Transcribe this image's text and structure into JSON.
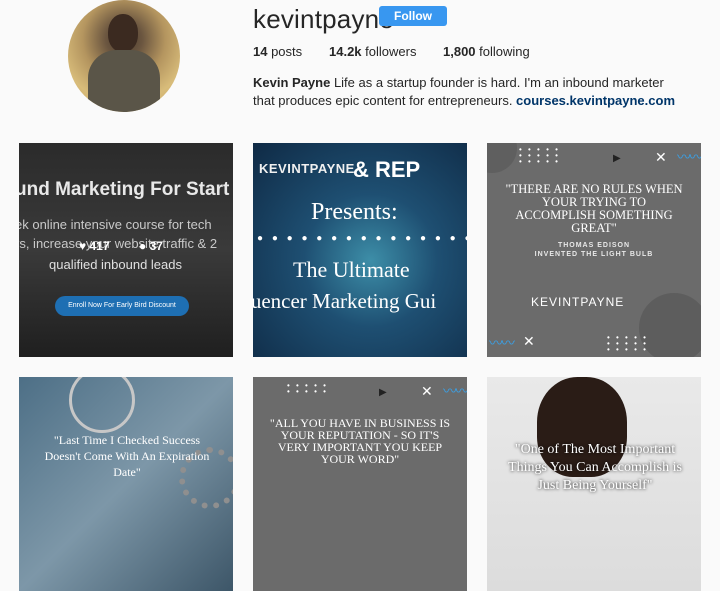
{
  "profile": {
    "username": "kevintpayne",
    "follow_label": "Follow",
    "posts_count": "14",
    "posts_label": " posts",
    "followers_count": "14.2k",
    "followers_label": " followers",
    "following_count": "1,800",
    "following_label": " following",
    "bio_name": "Kevin Payne",
    "bio_text": " Life as a startup founder is hard. I'm an inbound marketer that produces epic content for entrepreneurs. ",
    "bio_link": "courses.kevintpayne.com"
  },
  "posts": [
    {
      "title": "und Marketing For Start",
      "sub1": "ek online intensive course for tech",
      "sub2": "rs, increase your website traffic & 2",
      "sub3": "qualified inbound leads",
      "likes": "417",
      "comments": "37",
      "cta": "Enroll Now For Early Bird Discount"
    },
    {
      "brand": "KEVINTPAYNE",
      "rep": "& REP",
      "presents": "Presents:",
      "dots": "● ● ● ● ● ● ● ● ● ● ● ● ● ● ● ● ●",
      "ultimate": "The Ultimate",
      "influencer": "luencer Marketing Gui"
    },
    {
      "quote": "\"THERE ARE NO RULES WHEN YOUR TRYING TO ACCOMPLISH SOMETHING GREAT\"",
      "author": "THOMAS EDISON",
      "author_sub": "INVENTED THE LIGHT BULB",
      "logo": "KEVINTPAYNE"
    },
    {
      "quote": "\"Last Time I Checked Success Doesn't Come With An Expiration Date\""
    },
    {
      "quote": "\"ALL YOU HAVE IN BUSINESS IS YOUR REPUTATION - SO IT'S VERY IMPORTANT YOU KEEP YOUR WORD\""
    },
    {
      "quote": "\"One of The Most Important Things You Can Accomplish is Just Being Yourself\""
    }
  ],
  "icons": {
    "heart": "♥",
    "comment": "●",
    "close": "✕",
    "play": "▶",
    "wave": "〰〰"
  },
  "colors": {
    "follow": "#3897f0",
    "link": "#003569",
    "accent_wave": "#3aa0e6"
  }
}
